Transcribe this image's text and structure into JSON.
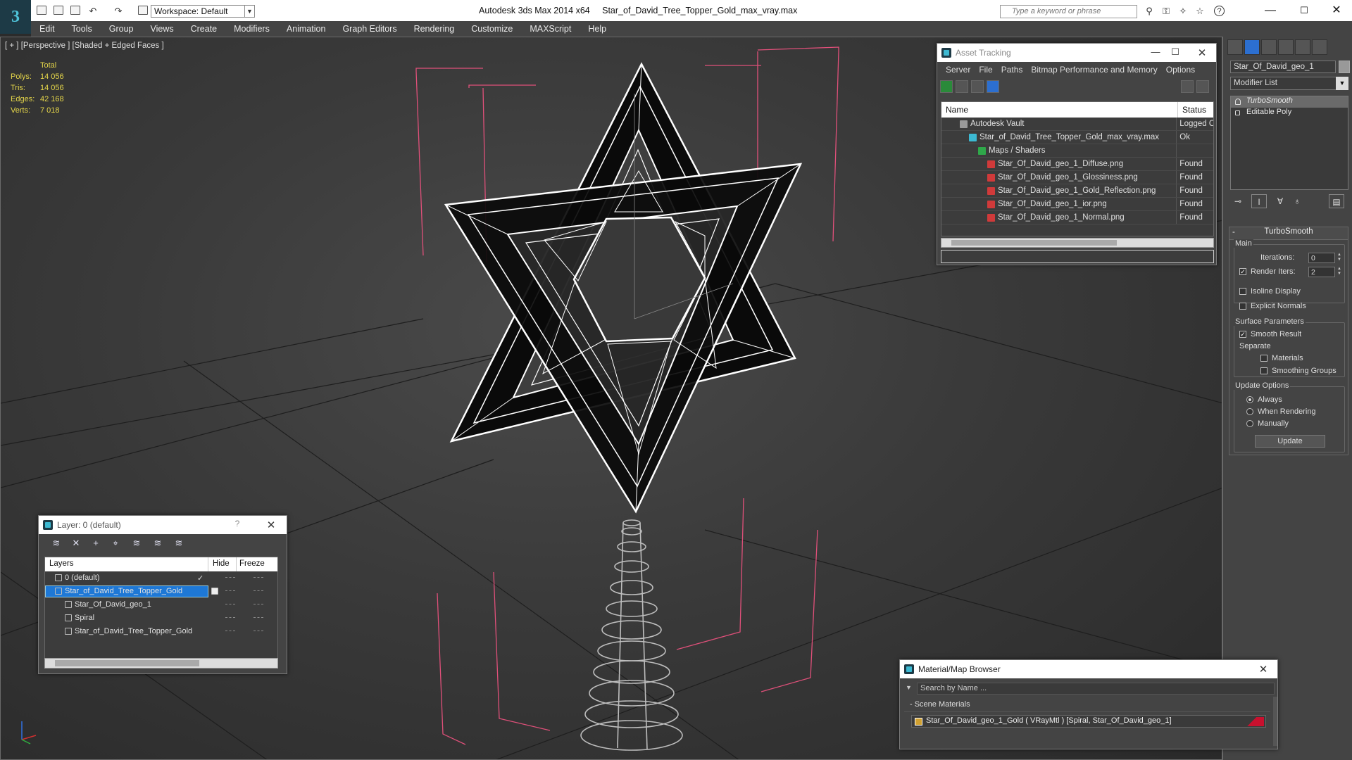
{
  "titlebar": {
    "app_name": "Autodesk 3ds Max  2014 x64",
    "file_name": "Star_of_David_Tree_Topper_Gold_max_vray.max",
    "workspace": "Workspace: Default",
    "search_placeholder": "Type a keyword or phrase"
  },
  "menu": [
    "Edit",
    "Tools",
    "Group",
    "Views",
    "Create",
    "Modifiers",
    "Animation",
    "Graph Editors",
    "Rendering",
    "Customize",
    "MAXScript",
    "Help"
  ],
  "viewport": {
    "label": "[ + ] [Perspective ] [Shaded + Edged Faces ]",
    "stats": {
      "header": "Total",
      "rows": [
        {
          "k": "Polys:",
          "v": "14 056"
        },
        {
          "k": "Tris:",
          "v": "14 056"
        },
        {
          "k": "Edges:",
          "v": "42 168"
        },
        {
          "k": "Verts:",
          "v": "7 018"
        }
      ]
    }
  },
  "asset_tracking": {
    "title": "Asset Tracking",
    "menu": [
      "Server",
      "File",
      "Paths",
      "Bitmap Performance and Memory",
      "Options"
    ],
    "columns": {
      "name": "Name",
      "status": "Status"
    },
    "rows": [
      {
        "name": "Autodesk Vault",
        "status": "Logged Out",
        "indent": 0,
        "icon": "vault-icon"
      },
      {
        "name": "Star_of_David_Tree_Topper_Gold_max_vray.max",
        "status": "Ok",
        "indent": 1,
        "icon": "max-file-icon"
      },
      {
        "name": "Maps / Shaders",
        "status": "",
        "indent": 2,
        "icon": "maps-folder-icon"
      },
      {
        "name": "Star_Of_David_geo_1_Diffuse.png",
        "status": "Found",
        "indent": 3,
        "icon": "png-icon"
      },
      {
        "name": "Star_Of_David_geo_1_Glossiness.png",
        "status": "Found",
        "indent": 3,
        "icon": "png-icon"
      },
      {
        "name": "Star_Of_David_geo_1_Gold_Reflection.png",
        "status": "Found",
        "indent": 3,
        "icon": "png-icon"
      },
      {
        "name": "Star_Of_David_geo_1_ior.png",
        "status": "Found",
        "indent": 3,
        "icon": "png-icon"
      },
      {
        "name": "Star_Of_David_geo_1_Normal.png",
        "status": "Found",
        "indent": 3,
        "icon": "png-icon"
      }
    ]
  },
  "command_panel": {
    "object_name": "Star_Of_David_geo_1",
    "modifier_list": "Modifier List",
    "stack": [
      {
        "label": "TurboSmooth",
        "selected": true
      },
      {
        "label": "Editable Poly",
        "selected": false
      }
    ],
    "turbosmooth": {
      "title": "TurboSmooth",
      "main_label": "Main",
      "iterations_label": "Iterations:",
      "iterations_value": "0",
      "render_iters_label": "Render Iters:",
      "render_iters_value": "2",
      "isoline_label": "Isoline Display",
      "explicit_normals_label": "Explicit Normals",
      "surface_params_label": "Surface Parameters",
      "smooth_result_label": "Smooth Result",
      "separate_label": "Separate",
      "materials_label": "Materials",
      "smoothing_groups_label": "Smoothing Groups",
      "update_options_label": "Update Options",
      "always_label": "Always",
      "when_rendering_label": "When Rendering",
      "manually_label": "Manually",
      "update_button": "Update"
    }
  },
  "layer_window": {
    "title": "Layer: 0 (default)",
    "help": "?",
    "columns": {
      "layers": "Layers",
      "hide": "Hide",
      "freeze": "Freeze"
    },
    "rows": [
      {
        "name": "0 (default)",
        "level": 0,
        "selected": false
      },
      {
        "name": "Star_of_David_Tree_Topper_Gold",
        "level": 0,
        "selected": true
      },
      {
        "name": "Star_Of_David_geo_1",
        "level": 1,
        "selected": false
      },
      {
        "name": "Spiral",
        "level": 1,
        "selected": false
      },
      {
        "name": "Star_of_David_Tree_Topper_Gold",
        "level": 1,
        "selected": false
      }
    ]
  },
  "material_browser": {
    "title": "Material/Map Browser",
    "search_placeholder": "Search by Name ...",
    "section": "- Scene Materials",
    "item": "Star_Of_David_geo_1_Gold  ( VRayMtl ) [Spiral, Star_Of_David_geo_1]",
    "swatch_color": "#c8102e"
  },
  "colors": {
    "viewport_bg": "#3a3a3a",
    "selection": "#1e78d6",
    "stats_text": "#e6d74a",
    "bbox_lines": "#e0507a"
  }
}
